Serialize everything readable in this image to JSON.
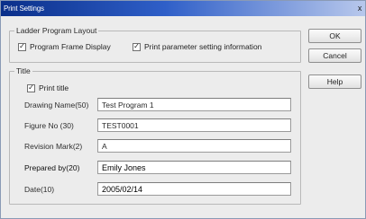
{
  "window": {
    "title": "Print Settings",
    "close_glyph": "x"
  },
  "layout_group": {
    "label": "Ladder Program Layout",
    "program_frame_display": {
      "label": "Program Frame Display",
      "checked": true
    },
    "print_parameter_info": {
      "label": "Print parameter setting information",
      "checked": true
    }
  },
  "title_group": {
    "label": "Title",
    "print_title": {
      "label": "Print title",
      "checked": true
    },
    "fields": [
      {
        "label": "Drawing Name(50)",
        "value": "Test Program 1"
      },
      {
        "label": "Figure No (30)",
        "value": "TEST0001"
      },
      {
        "label": "Revision Mark(2)",
        "value": "A"
      },
      {
        "label": "Prepared by(20)",
        "value": "Emily Jones"
      },
      {
        "label": "Date(10)",
        "value": "2005/02/14"
      }
    ]
  },
  "buttons": {
    "ok": "OK",
    "cancel": "Cancel",
    "help": "Help"
  },
  "check_glyph": "✓"
}
